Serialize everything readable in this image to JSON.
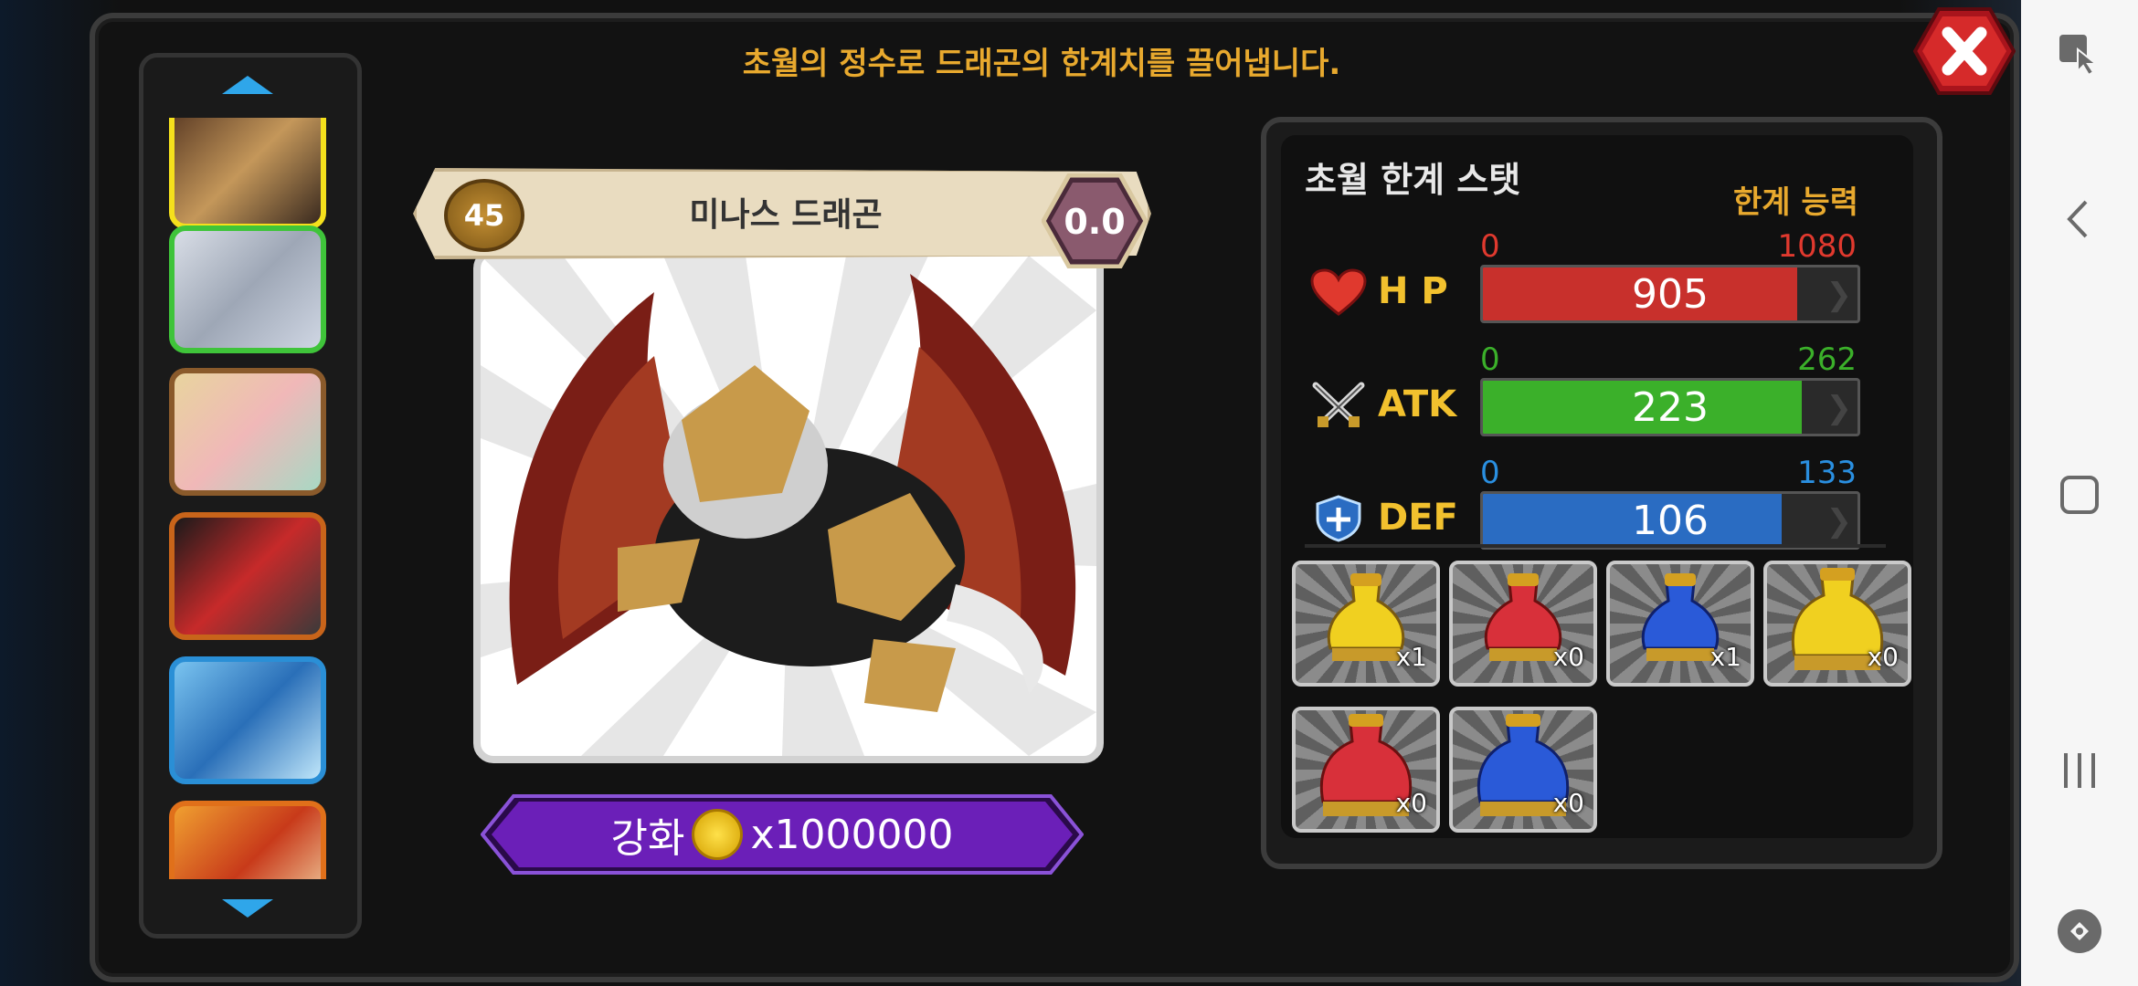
{
  "header": {
    "title": "초월의 정수로 드래곤의 한계치를 끌어냅니다."
  },
  "card": {
    "level": "45",
    "name": "미나스 드래곤",
    "badge": "0.0"
  },
  "enhance": {
    "label": "강화",
    "cost": "x1000000"
  },
  "stats": {
    "title": "초월 한계 스탯",
    "subtitle": "한계 능력",
    "rows": [
      {
        "label": "H P",
        "min": "0",
        "max": "1080",
        "value": "905",
        "fill": 0.838,
        "color": "#c8302c",
        "min_color": "#e0392e"
      },
      {
        "label": "ATK",
        "min": "0",
        "max": "262",
        "value": "223",
        "fill": 0.851,
        "color": "#3bb02a",
        "min_color": "#3bb02a"
      },
      {
        "label": "DEF",
        "min": "0",
        "max": "133",
        "value": "106",
        "fill": 0.797,
        "color": "#2a6cc2",
        "min_color": "#2a8fe0"
      }
    ]
  },
  "items": [
    {
      "icon": "yellow-potion-icon",
      "count": "x1"
    },
    {
      "icon": "red-potion-icon",
      "count": "x0"
    },
    {
      "icon": "blue-potion-icon",
      "count": "x1"
    },
    {
      "icon": "large-yellow-potion-icon",
      "count": "x0"
    },
    {
      "icon": "large-red-potion-icon",
      "count": "x0"
    },
    {
      "icon": "large-blue-potion-icon",
      "count": "x0"
    }
  ],
  "colors": {
    "accent": "#e8a92e",
    "purple": "#6b1fb8",
    "blue_arrow": "#2fa6ea"
  }
}
